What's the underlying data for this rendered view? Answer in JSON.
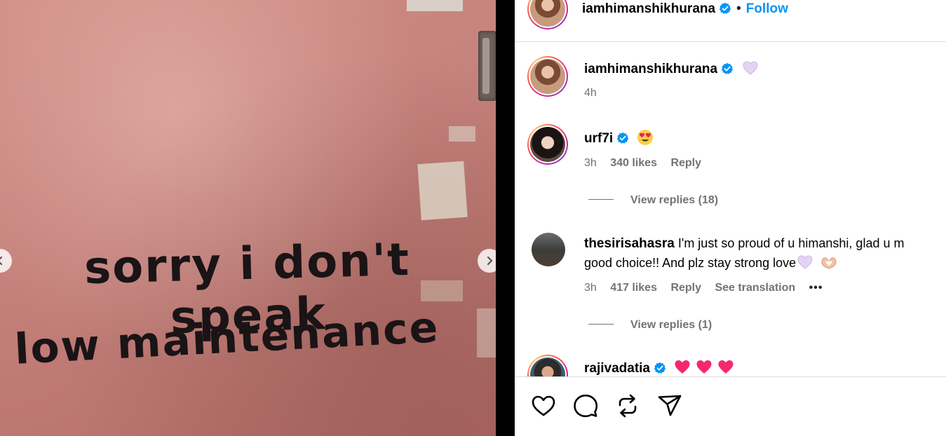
{
  "post": {
    "image_text_line1": "sorry i don't speak",
    "image_text_line2": "low maintenance"
  },
  "header": {
    "username": "iamhimanshikhurana",
    "separator": "•",
    "follow_label": "Follow"
  },
  "caption": {
    "username": "iamhimanshikhurana",
    "time": "4h"
  },
  "comments": [
    {
      "username": "urf7i",
      "verified": true,
      "time": "3h",
      "likes": "340 likes",
      "reply_label": "Reply",
      "view_replies": "View replies (18)"
    },
    {
      "username": "thesirisahasra",
      "verified": false,
      "text_line1": "I'm just so proud of u himanshi, glad u m",
      "text_line2": "good choice!! And plz stay strong love",
      "time": "3h",
      "likes": "417 likes",
      "reply_label": "Reply",
      "translation_label": "See translation",
      "more_label": "•••",
      "view_replies": "View replies (1)"
    },
    {
      "username": "rajivadatia",
      "verified": true
    }
  ],
  "icons": {
    "like": "heart-outline-icon",
    "comment": "comment-bubble-icon",
    "repost": "repost-arrows-icon",
    "share": "paper-plane-icon",
    "verified": "verified-badge-icon"
  },
  "colors": {
    "accent": "#0095f6",
    "verified": "#0095f6",
    "secondary_text": "#737373",
    "border": "#dbdbdb"
  }
}
